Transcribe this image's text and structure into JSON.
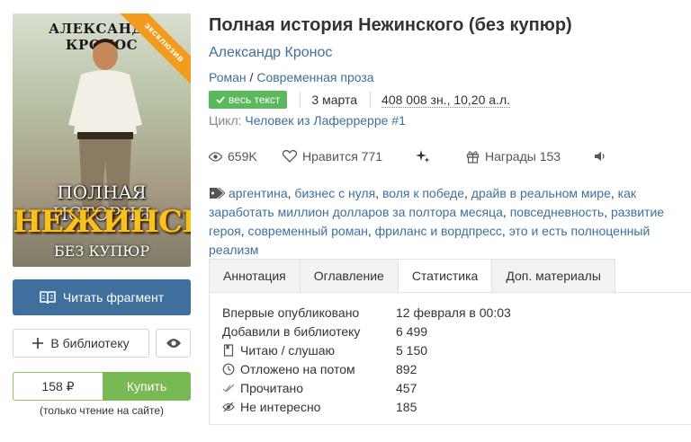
{
  "cover": {
    "author_text": "АЛЕКСАНДР КРОНОС",
    "ribbon": "эксклюзив",
    "title_line1": "ПОЛНАЯ ИСТОРИЯ",
    "title_line2": "НЕЖИНСКОГО",
    "title_line3": "БЕЗ КУПЮР"
  },
  "actions": {
    "read_label": "Читать фрагмент",
    "library_label": "В библиотеку",
    "price": "158 ₽",
    "buy_label": "Купить",
    "price_note": "(только чтение на сайте)"
  },
  "book": {
    "title": "Полная история Нежинского (без купюр)",
    "author": "Александр Кронос",
    "genre1": "Роман",
    "genre_sep": " / ",
    "genre2": "Современная проза",
    "status_badge": "весь текст",
    "date": "3 марта",
    "size": "408 008 зн., 10,20 а.л.",
    "cycle_label": "Цикл: ",
    "cycle_name": "Человек из Лаферрерре #1"
  },
  "stats": {
    "views": "659K",
    "likes": "Нравится 771",
    "awards": "Награды 153"
  },
  "tags": [
    "аргентина",
    "бизнес с нуля",
    "воля к победе",
    "драйв в реальном мире",
    "как заработать миллион долларов за полтора месяца",
    "повседневность",
    "развитие героя",
    "современный роман",
    "фриланс и вордпресс",
    "это и есть полноценный реализм"
  ],
  "tabs": [
    "Аннотация",
    "Оглавление",
    "Статистика",
    "Доп. материалы"
  ],
  "statistics": {
    "first_published_label": "Впервые опубликовано",
    "first_published_value": "12 февраля в 00:03",
    "added_label": "Добавили в библиотеку",
    "added_value": "6 499",
    "reading_label": "Читаю / слушаю",
    "reading_value": "5 150",
    "later_label": "Отложено на потом",
    "later_value": "892",
    "read_label": "Прочитано",
    "read_value": "457",
    "not_interested_label": "Не интересно",
    "not_interested_value": "185"
  },
  "colors": {
    "link": "#3f6f9d",
    "primary_button": "#3f6f9d",
    "buy_button": "#78b953",
    "badge": "#5cb85c",
    "ribbon": "#f39b1d"
  }
}
